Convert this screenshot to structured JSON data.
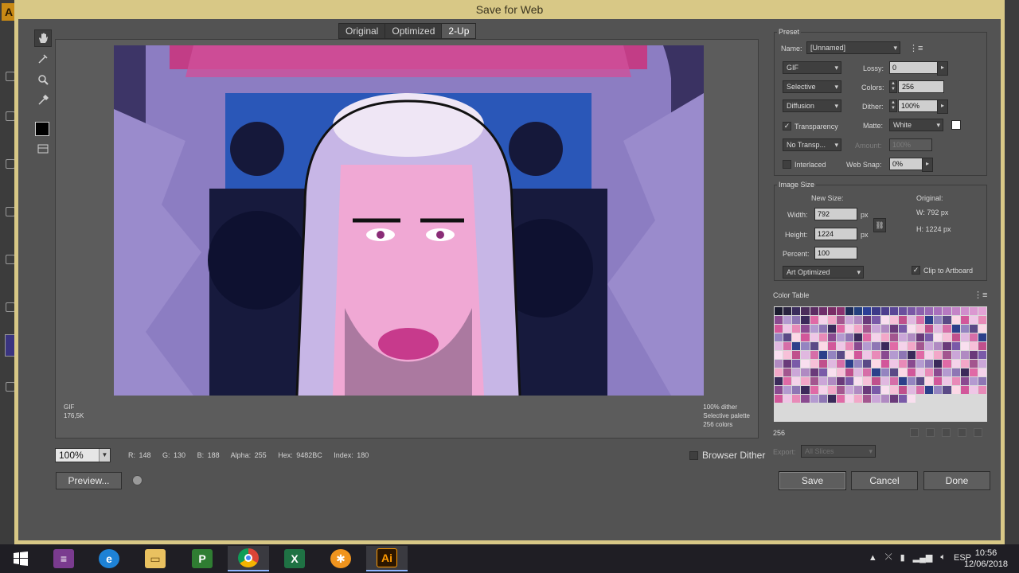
{
  "window": {
    "title": "Save for Web"
  },
  "view_tabs": [
    {
      "label": "Original",
      "active": false
    },
    {
      "label": "Optimized",
      "active": false
    },
    {
      "label": "2-Up",
      "active": true
    }
  ],
  "tools": [
    "hand-tool",
    "slice-select-tool",
    "zoom-tool",
    "eyedropper-tool",
    "eyedropper-color",
    "toggle-slices"
  ],
  "preview": {
    "format": "GIF",
    "size": "176,5K",
    "dither": "100% dither",
    "palette": "Selective palette",
    "colors": "256 colors"
  },
  "zoom": "100%",
  "pixel_info": {
    "r": "R: 148",
    "g": "G: 130",
    "b": "B: 188",
    "alpha": "Alpha: 255",
    "hex": "Hex: 9482BC",
    "index": "Index: 180"
  },
  "browser_dither": "Browser Dither",
  "preview_button": "Preview...",
  "preset": {
    "title": "Preset",
    "name_label": "Name:",
    "name_value": "[Unnamed]",
    "format": "GIF",
    "lossy_label": "Lossy:",
    "lossy_value": "0",
    "reduction": "Selective",
    "colors_label": "Colors:",
    "colors_value": "256",
    "dither_algo": "Diffusion",
    "dither_label": "Dither:",
    "dither_value": "100%",
    "transparency_label": "Transparency",
    "matte_label": "Matte:",
    "matte_value": "White",
    "transparency_dither": "No Transp...",
    "amount_label": "Amount:",
    "amount_value": "100%",
    "interlaced_label": "Interlaced",
    "websnap_label": "Web Snap:",
    "websnap_value": "0%"
  },
  "image_size": {
    "title": "Image Size",
    "new_size_label": "New Size:",
    "width_label": "Width:",
    "width_value": "792",
    "height_label": "Height:",
    "height_value": "1224",
    "unit": "px",
    "percent_label": "Percent:",
    "percent_value": "100",
    "quality": "Art Optimized",
    "original_label": "Original:",
    "orig_w": "W:  792 px",
    "orig_h": "H:  1224 px",
    "clip_label": "Clip to Artboard"
  },
  "color_table": {
    "title": "Color Table",
    "count": "256",
    "export_label": "Export:",
    "export_value": "All Slices",
    "palette": [
      "#1b1b2e",
      "#2a2440",
      "#3a2d5c",
      "#4a2d5a",
      "#5c2d63",
      "#6e2f6b",
      "#7a2d66",
      "#8a3270",
      "#1d2c58",
      "#23407e",
      "#2b3f96",
      "#3c3a88",
      "#4c3f8e",
      "#5b4796",
      "#6a4f9d",
      "#7a57a5",
      "#8b60ad",
      "#9a68b5",
      "#a970bc",
      "#b77ac2",
      "#c484c7",
      "#d08ecd",
      "#db98d1",
      "#e4a3d6"
    ],
    "palette_cycle": [
      "#3b2a5a",
      "#6a3a7a",
      "#2c3f8a",
      "#8a4a90",
      "#a3568f",
      "#c0508c",
      "#d2579a",
      "#e06aa6",
      "#7a5aa8",
      "#9484c0",
      "#b49ad0",
      "#cba6d8",
      "#e0b8e0",
      "#efc6e6",
      "#f5d2ea",
      "#f9dfef",
      "#5a4a86",
      "#8e76b4",
      "#b08ac2",
      "#d66ea8",
      "#e88ab8",
      "#f2a7c8",
      "#f7c0d8",
      "#fcd8e6"
    ]
  },
  "buttons": {
    "save": "Save",
    "cancel": "Cancel",
    "done": "Done"
  },
  "taskbar": {
    "apps": [
      "winrar",
      "internet-explorer",
      "file-explorer",
      "project",
      "chrome",
      "excel",
      "settings",
      "illustrator"
    ],
    "language": "ESP",
    "time": "10:56",
    "date": "12/06/2018"
  }
}
